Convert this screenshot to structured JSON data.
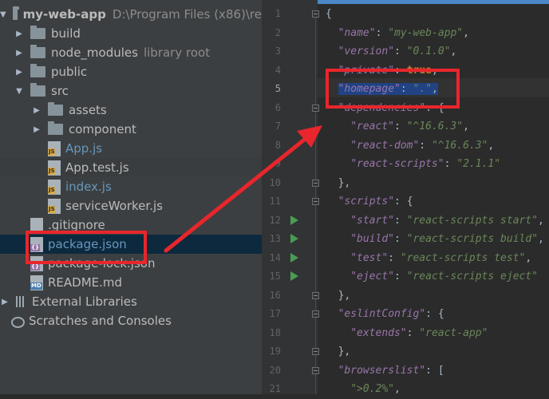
{
  "project_tree": {
    "root": {
      "name": "my-web-app",
      "path": "D:\\Program Files (x86)\\re"
    },
    "items": [
      {
        "label": "build",
        "type": "folder"
      },
      {
        "label": "node_modules",
        "suffix": "library root",
        "type": "folder"
      },
      {
        "label": "public",
        "type": "folder"
      },
      {
        "label": "src",
        "type": "folder"
      },
      {
        "label": "assets",
        "type": "folder"
      },
      {
        "label": "component",
        "type": "folder"
      },
      {
        "label": "App.js",
        "type": "js"
      },
      {
        "label": "App.test.js",
        "type": "js"
      },
      {
        "label": "index.js",
        "type": "js"
      },
      {
        "label": "serviceWorker.js",
        "type": "js"
      },
      {
        "label": ".gitignore",
        "type": "file"
      },
      {
        "label": "package.json",
        "type": "json"
      },
      {
        "label": "package-lock.json",
        "type": "json"
      },
      {
        "label": "README.md",
        "type": "md"
      },
      {
        "label": "External Libraries",
        "type": "library"
      },
      {
        "label": "Scratches and Consoles",
        "type": "scratch"
      }
    ],
    "icon_tags": {
      "js": "JS",
      "json": "{}",
      "md": "MD"
    }
  },
  "editor": {
    "line_numbers": [
      "1",
      "2",
      "3",
      "4",
      "5",
      "6",
      "7",
      "8",
      "9",
      "10",
      "11",
      "12",
      "13",
      "14",
      "15",
      "16",
      "17",
      "18",
      "19",
      "20",
      "21"
    ],
    "lines": [
      [
        [
          "p",
          "{"
        ]
      ],
      [
        [
          "k",
          "\"name\""
        ],
        [
          "p",
          ": "
        ],
        [
          "s",
          "\"my-web-app\""
        ],
        [
          "p",
          ","
        ]
      ],
      [
        [
          "k",
          "\"version\""
        ],
        [
          "p",
          ": "
        ],
        [
          "s",
          "\"0.1.0\""
        ],
        [
          "p",
          ","
        ]
      ],
      [
        [
          "k",
          "\"private\""
        ],
        [
          "p",
          ": "
        ],
        [
          "kw",
          "true"
        ],
        [
          "p",
          ","
        ]
      ],
      [
        [
          "k",
          "\"homepage\""
        ],
        [
          "p",
          ": "
        ],
        [
          "s",
          "\".\""
        ],
        [
          "p",
          ","
        ]
      ],
      [
        [
          "k",
          "\"dependencies\""
        ],
        [
          "p",
          ": {"
        ]
      ],
      [
        [
          "k",
          "\"react\""
        ],
        [
          "p",
          ": "
        ],
        [
          "s",
          "\"^16.6.3\""
        ],
        [
          "p",
          ","
        ]
      ],
      [
        [
          "k",
          "\"react-dom\""
        ],
        [
          "p",
          ": "
        ],
        [
          "s",
          "\"^16.6.3\""
        ],
        [
          "p",
          ","
        ]
      ],
      [
        [
          "k",
          "\"react-scripts\""
        ],
        [
          "p",
          ": "
        ],
        [
          "s",
          "\"2.1.1\""
        ]
      ],
      [
        [
          "p",
          "},"
        ]
      ],
      [
        [
          "k",
          "\"scripts\""
        ],
        [
          "p",
          ": {"
        ]
      ],
      [
        [
          "k",
          "\"start\""
        ],
        [
          "p",
          ": "
        ],
        [
          "s",
          "\"react-scripts start\""
        ],
        [
          "p",
          ","
        ]
      ],
      [
        [
          "k",
          "\"build\""
        ],
        [
          "p",
          ": "
        ],
        [
          "s",
          "\"react-scripts build\""
        ],
        [
          "p",
          ","
        ]
      ],
      [
        [
          "k",
          "\"test\""
        ],
        [
          "p",
          ": "
        ],
        [
          "s",
          "\"react-scripts test\""
        ],
        [
          "p",
          ","
        ]
      ],
      [
        [
          "k",
          "\"eject\""
        ],
        [
          "p",
          ": "
        ],
        [
          "s",
          "\"react-scripts eject\""
        ]
      ],
      [
        [
          "p",
          "},"
        ]
      ],
      [
        [
          "k",
          "\"eslintConfig\""
        ],
        [
          "p",
          ": {"
        ]
      ],
      [
        [
          "k",
          "\"extends\""
        ],
        [
          "p",
          ": "
        ],
        [
          "s",
          "\"react-app\""
        ]
      ],
      [
        [
          "p",
          "},"
        ]
      ],
      [
        [
          "k",
          "\"browserslist\""
        ],
        [
          "p",
          ": ["
        ]
      ],
      [
        [
          "s",
          "\">0.2%\""
        ],
        [
          "p",
          ","
        ]
      ]
    ]
  },
  "colors": {
    "annotation": "#e8262c",
    "selection": "#214283",
    "tree_selected": "#0d293e"
  }
}
